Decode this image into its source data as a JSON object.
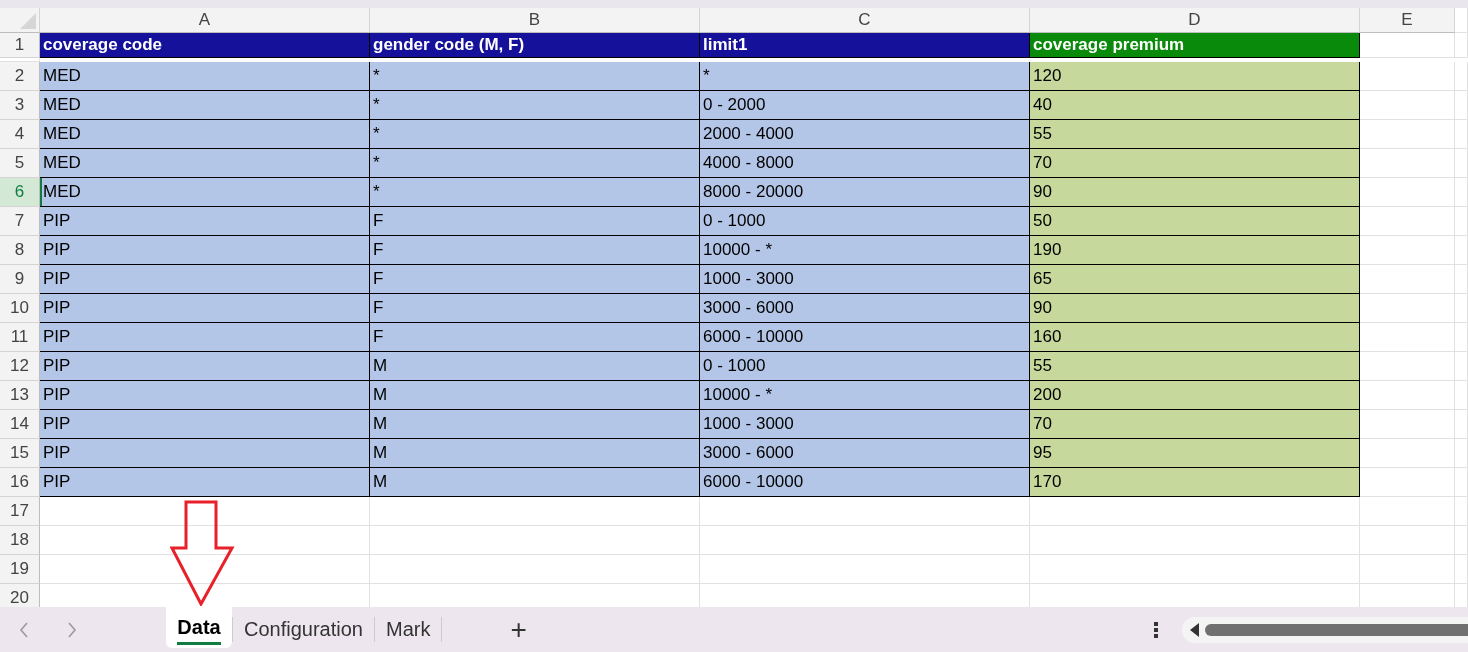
{
  "columns": [
    {
      "letter": "A",
      "selected": false
    },
    {
      "letter": "B",
      "selected": false
    },
    {
      "letter": "C",
      "selected": false
    },
    {
      "letter": "D",
      "selected": false
    },
    {
      "letter": "E",
      "selected": false
    }
  ],
  "header_row": {
    "number": "1",
    "selected": false,
    "cells": [
      {
        "text": "coverage code",
        "color": "#16119a",
        "kind": "input"
      },
      {
        "text": "gender code (M, F)",
        "color": "#16119a",
        "kind": "input"
      },
      {
        "text": "limit1",
        "color": "#16119a",
        "kind": "input"
      },
      {
        "text": "coverage premium",
        "color": "#0a8a0a",
        "kind": "output"
      }
    ]
  },
  "rows": [
    {
      "number": "2",
      "selected": false,
      "cells": [
        "MED",
        "*",
        "*",
        "120"
      ]
    },
    {
      "number": "3",
      "selected": false,
      "cells": [
        "MED",
        "*",
        "0 - 2000",
        "40"
      ]
    },
    {
      "number": "4",
      "selected": false,
      "cells": [
        "MED",
        "*",
        "2000 - 4000",
        "55"
      ]
    },
    {
      "number": "5",
      "selected": false,
      "cells": [
        "MED",
        "*",
        "4000 - 8000",
        "70"
      ]
    },
    {
      "number": "6",
      "selected": true,
      "cells": [
        "MED",
        "*",
        "8000 - 20000",
        "90"
      ]
    },
    {
      "number": "7",
      "selected": false,
      "cells": [
        "PIP",
        "F",
        "0 - 1000",
        "50"
      ]
    },
    {
      "number": "8",
      "selected": false,
      "cells": [
        "PIP",
        "F",
        "10000 - *",
        "190"
      ]
    },
    {
      "number": "9",
      "selected": false,
      "cells": [
        "PIP",
        "F",
        "1000 - 3000",
        "65"
      ]
    },
    {
      "number": "10",
      "selected": false,
      "cells": [
        "PIP",
        "F",
        "3000 - 6000",
        "90"
      ]
    },
    {
      "number": "11",
      "selected": false,
      "cells": [
        "PIP",
        "F",
        "6000 - 10000",
        "160"
      ]
    },
    {
      "number": "12",
      "selected": false,
      "cells": [
        "PIP",
        "M",
        "0 - 1000",
        "55"
      ]
    },
    {
      "number": "13",
      "selected": false,
      "cells": [
        "PIP",
        "M",
        "10000 - *",
        "200"
      ]
    },
    {
      "number": "14",
      "selected": false,
      "cells": [
        "PIP",
        "M",
        "1000 - 3000",
        "70"
      ]
    },
    {
      "number": "15",
      "selected": false,
      "cells": [
        "PIP",
        "M",
        "3000 - 6000",
        "95"
      ]
    },
    {
      "number": "16",
      "selected": false,
      "cells": [
        "PIP",
        "M",
        "6000 - 10000",
        "170"
      ]
    },
    {
      "number": "17",
      "selected": false,
      "cells": []
    },
    {
      "number": "18",
      "selected": false,
      "cells": []
    },
    {
      "number": "19",
      "selected": false,
      "cells": []
    },
    {
      "number": "20",
      "selected": false,
      "cells": []
    }
  ],
  "sheet_tabs": [
    {
      "label": "Data",
      "selected": true
    },
    {
      "label": "Configuration",
      "selected": false
    },
    {
      "label": "Mark",
      "selected": false
    }
  ],
  "add_sheet": "+"
}
